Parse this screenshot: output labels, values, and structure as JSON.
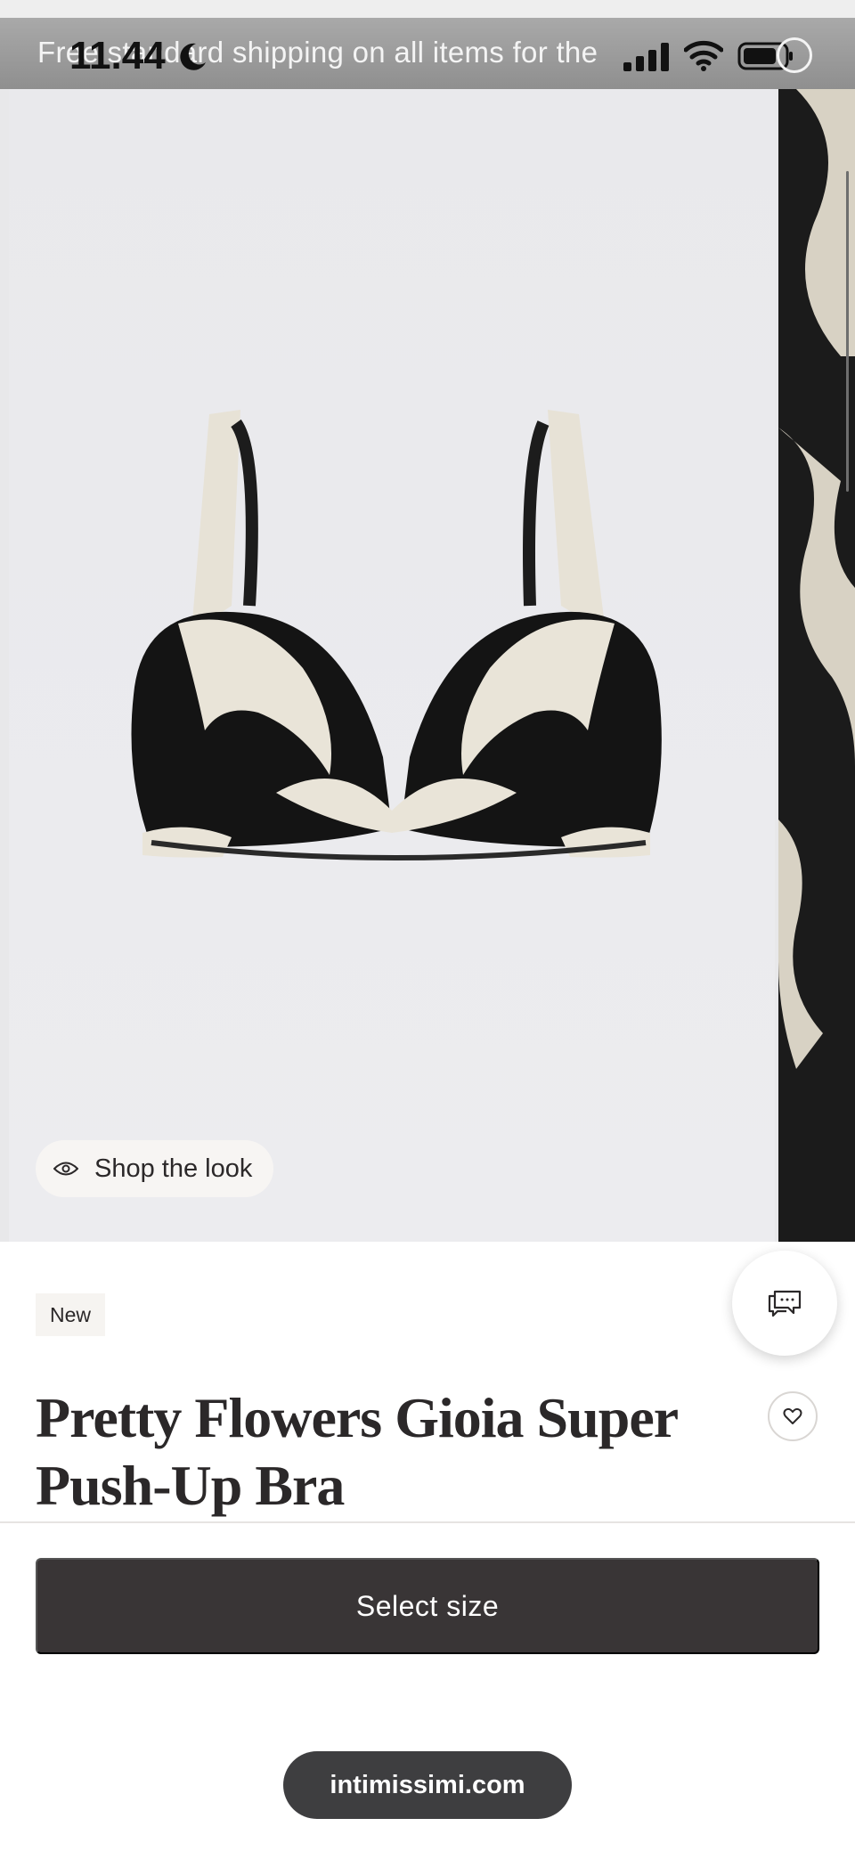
{
  "status_bar": {
    "time": "11.44",
    "promo_text": "Free standard shipping on all items for the"
  },
  "gallery": {
    "shop_the_look_label": "Shop the look"
  },
  "product": {
    "badge": "New",
    "title": "Pretty Flowers Gioia Super Push-Up Bra"
  },
  "actions": {
    "select_size_label": "Select size"
  },
  "browser": {
    "url": "intimissimi.com"
  },
  "colors": {
    "button_dark": "#393536",
    "text": "#2b2829",
    "image_background": "#e9e9ec"
  }
}
